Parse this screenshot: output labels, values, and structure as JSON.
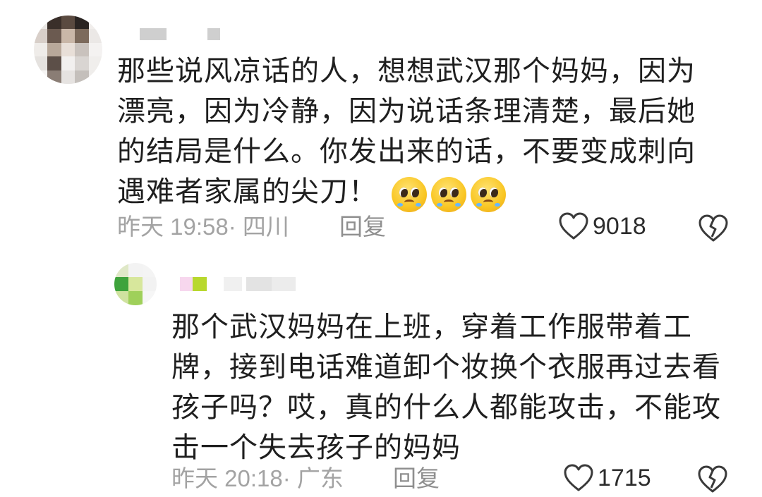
{
  "comment": {
    "text": "那些说风凉话的人，想想武汉那个妈妈，因为漂亮，因为冷静，因为说话条理清楚，最后她的结局是什么。你发出来的话，不要变成刺向遇难者家属的尖刀！",
    "emojis": [
      "pleading-face-emoji",
      "pleading-face-emoji",
      "pleading-face-emoji"
    ],
    "time_location": "昨天 19:58· 四川",
    "reply_label": "回复",
    "likes": "9018"
  },
  "reply": {
    "text": "那个武汉妈妈在上班，穿着工作服带着工牌，接到电话难道卸个妆换个衣服再过去看孩子吗？哎，真的什么人都能攻击，不能攻击一个失去孩子的妈妈",
    "time_location": "昨天 20:18· 广东",
    "reply_label": "回复",
    "likes": "1715"
  },
  "colors": {
    "text": "#1f1f1f",
    "meta": "#a3a3a3",
    "like_icon": "#3a3a3a"
  }
}
